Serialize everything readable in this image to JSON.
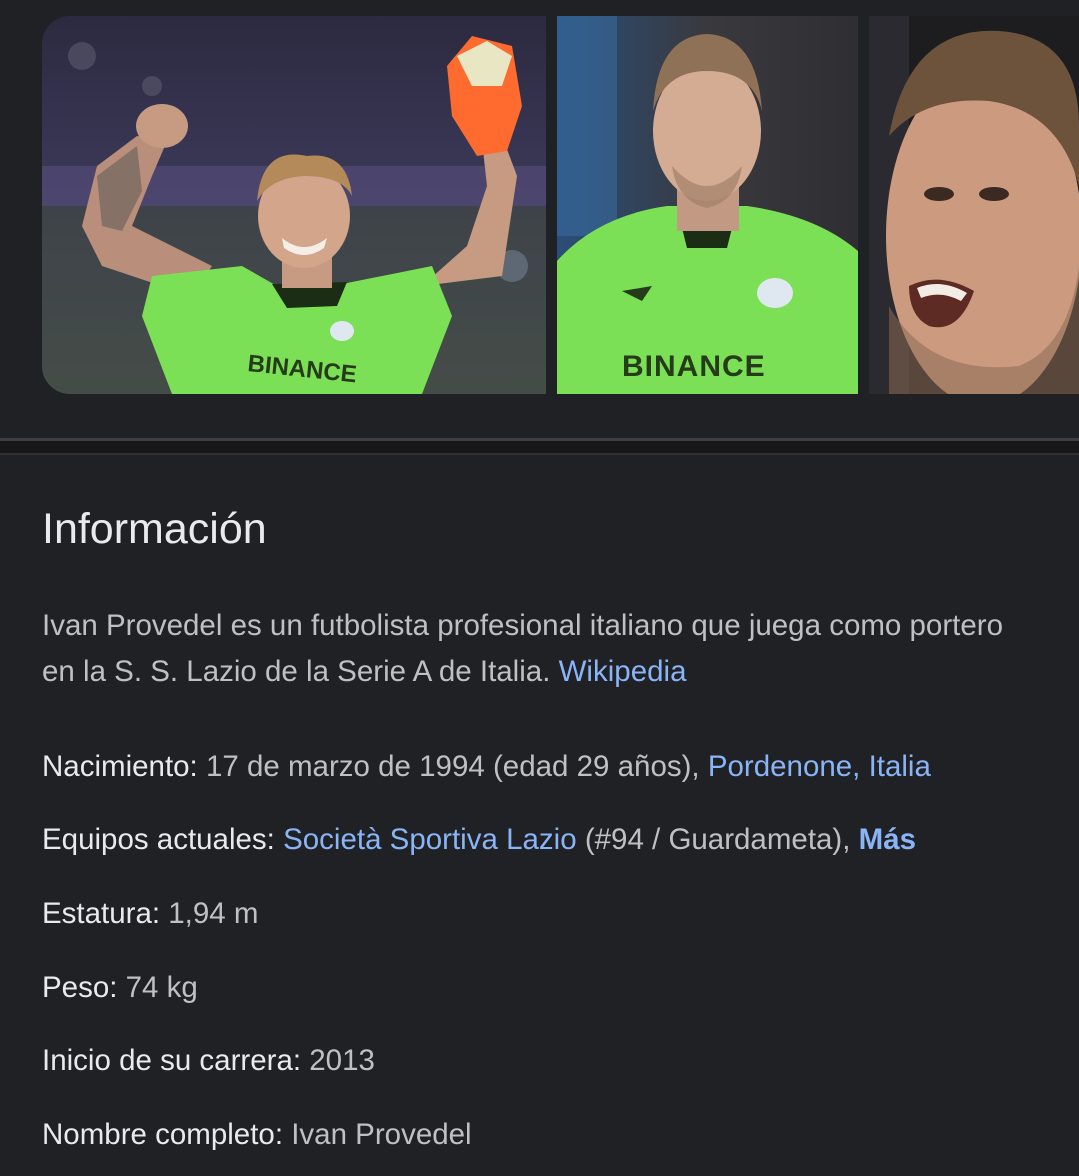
{
  "gallery": {
    "images": [
      {
        "alt": "goalkeeper-celebrating"
      },
      {
        "alt": "goalkeeper-portrait"
      },
      {
        "alt": "goalkeeper-face-closeup"
      }
    ],
    "jersey_text": "BINANCE"
  },
  "info": {
    "title": "Información",
    "description": "Ivan Provedel es un futbolista profesional italiano que juega como portero en la S. S. Lazio de la Serie A de Italia.",
    "source_link": "Wikipedia",
    "facts": {
      "birth": {
        "label": "Nacimiento:",
        "value": "17 de marzo de 1994 (edad 29 años),",
        "link": "Pordenone, Italia"
      },
      "teams": {
        "label": "Equipos actuales:",
        "link": "Società Sportiva Lazio",
        "value": "(#94 / Guardameta),",
        "more": "Más"
      },
      "height": {
        "label": "Estatura:",
        "value": "1,94 m"
      },
      "weight": {
        "label": "Peso:",
        "value": "74 kg"
      },
      "career_start": {
        "label": "Inicio de su carrera:",
        "value": "2013"
      },
      "full_name": {
        "label": "Nombre completo:",
        "value": "Ivan Provedel"
      }
    }
  },
  "colors": {
    "background": "#202124",
    "link": "#8ab4f8",
    "text_primary": "#e8eaed",
    "text_secondary": "#bdc1c6",
    "jersey": "#7be055"
  }
}
